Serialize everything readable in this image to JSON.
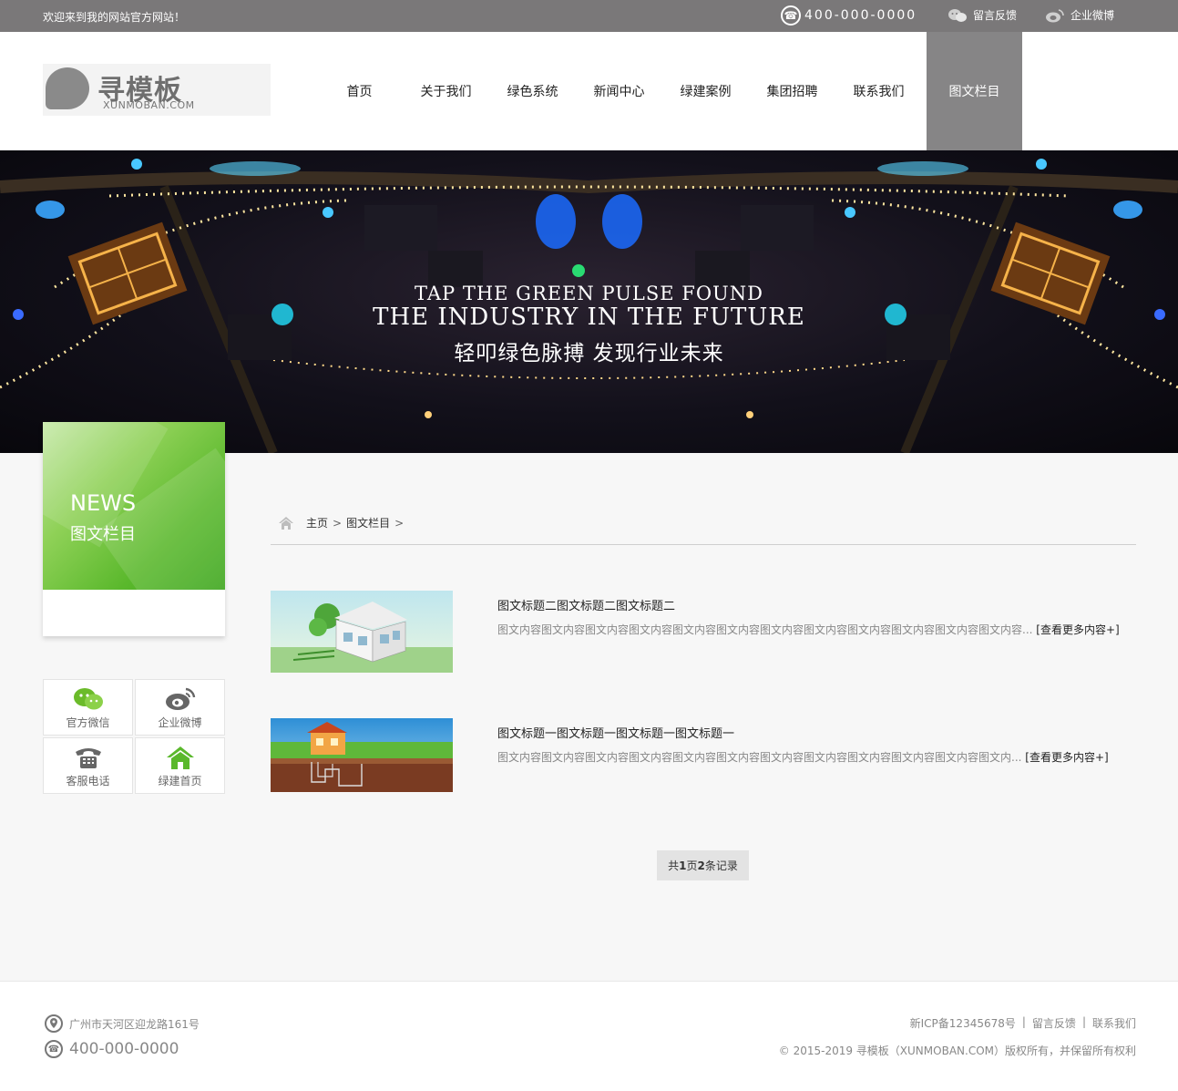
{
  "topbar": {
    "welcome": "欢迎来到我的网站官方网站！",
    "phone": "400-000-0000",
    "links": [
      {
        "label": "留言反馈",
        "icon": "wechat-icon"
      },
      {
        "label": "企业微博",
        "icon": "weibo-icon"
      }
    ]
  },
  "logo": {
    "name": "寻模板",
    "sub": "XUNMOBAN.COM"
  },
  "nav": [
    "首页",
    "关于我们",
    "绿色系统",
    "新闻中心",
    "绿建案例",
    "集团招聘",
    "联系我们",
    "图文栏目"
  ],
  "banner": {
    "line1": "TAP THE GREEN PULSE FOUND",
    "line2": "THE INDUSTRY IN THE FUTURE",
    "line3": "轻叩绿色脉搏 发现行业未来"
  },
  "side": {
    "en": "NEWS",
    "cn": "图文栏目",
    "quick": [
      {
        "label": "官方微信",
        "icon": "wechat-icon"
      },
      {
        "label": "企业微博",
        "icon": "weibo-icon"
      },
      {
        "label": "客服电话",
        "icon": "telephone-icon"
      },
      {
        "label": "绿建首页",
        "icon": "home-icon"
      }
    ]
  },
  "breadcrumb": {
    "home": "主页",
    "current": "图文栏目",
    "separator": ">"
  },
  "articles": [
    {
      "title": "图文标题二图文标题二图文标题二",
      "desc": "图文内容图文内容图文内容图文内容图文内容图文内容图文内容图文内容图文内容图文内容图文内容图文内容...",
      "more": "[查看更多内容+]"
    },
    {
      "title": "图文标题一图文标题一图文标题一图文标题一",
      "desc": "图文内容图文内容图文内容图文内容图文内容图文内容图文内容图文内容图文内容图文内容图文内容图文内...",
      "more": "[查看更多内容+]"
    }
  ],
  "pager": {
    "prefix": "共 ",
    "pages": "1",
    "mid": "页",
    "records": "2",
    "suffix": "条记录"
  },
  "footer": {
    "address": "广州市天河区迎龙路161号",
    "phone": "400-000-0000",
    "links": [
      "新ICP备12345678号",
      "留言反馈",
      "联系我们"
    ],
    "link_separator": "|",
    "copyright": "© 2015-2019 寻模板（XUNMOBAN.COM）版权所有，并保留所有权利"
  },
  "colors": {
    "topbar": "#7a7879",
    "nav_active": "#868586",
    "green": "#5ab82c"
  }
}
